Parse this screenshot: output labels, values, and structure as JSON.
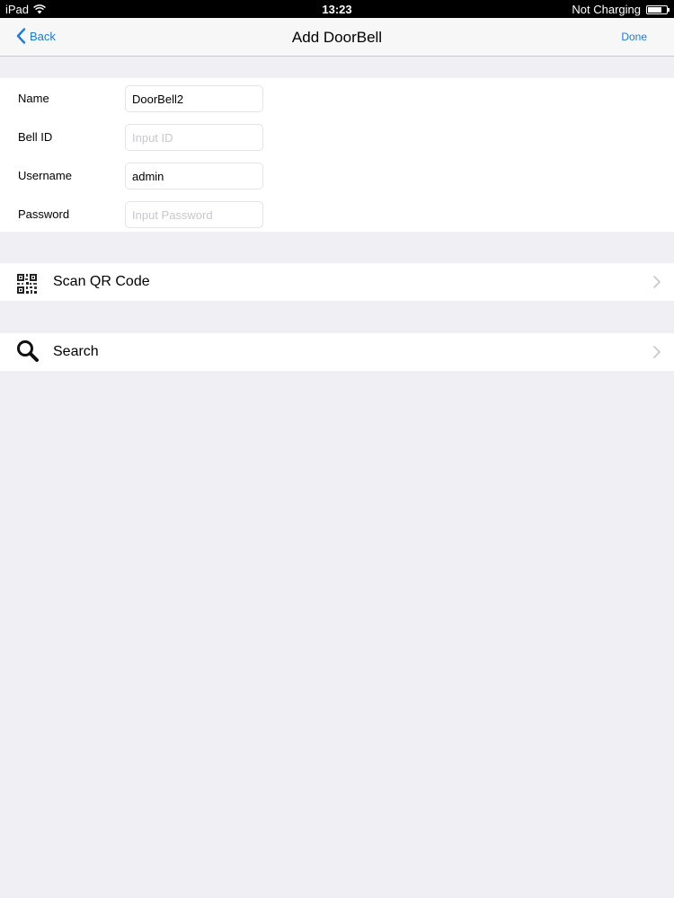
{
  "status_bar": {
    "device": "iPad",
    "time": "13:23",
    "charging": "Not Charging",
    "battery_level": 0.75
  },
  "nav": {
    "back_label": "Back",
    "title": "Add DoorBell",
    "done_label": "Done"
  },
  "form": {
    "name_label": "Name",
    "name_value": "DoorBell2",
    "bell_id_label": "Bell ID",
    "bell_id_placeholder": "Input ID",
    "username_label": "Username",
    "username_value": "admin",
    "password_label": "Password",
    "password_placeholder": "Input Password"
  },
  "actions": {
    "scan_label": "Scan QR Code",
    "scan_icon": "qr-code-icon",
    "search_label": "Search",
    "search_icon": "magnifier-icon"
  },
  "colors": {
    "accent": "#1a7ae0",
    "background": "#efeff4"
  }
}
